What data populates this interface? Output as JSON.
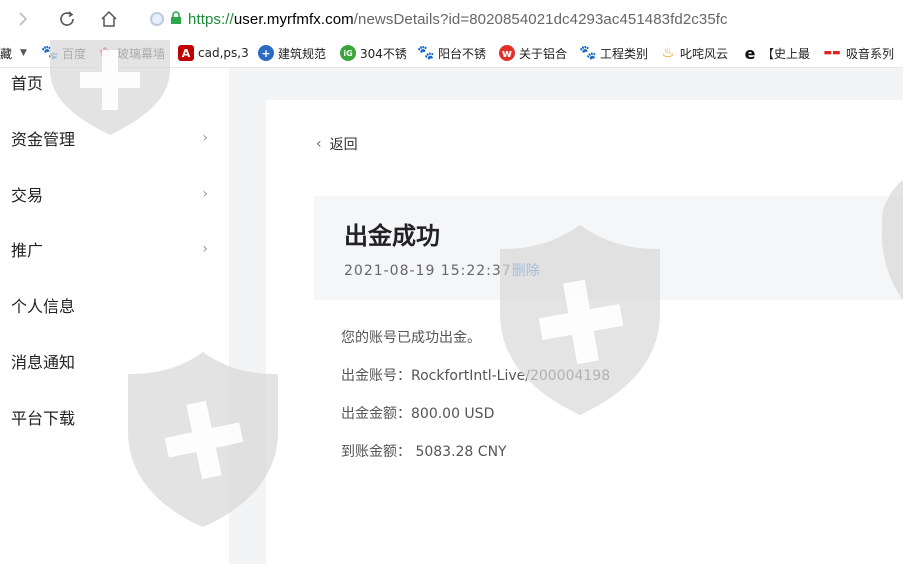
{
  "browser": {
    "url_scheme": "https://",
    "url_host": "user.myrfmfx.com",
    "url_path": "/newsDetails?id=8020854021dc4293ac451483fd2c35fc"
  },
  "bookmarks": [
    {
      "label": "收藏",
      "icon": "bookmark-icon",
      "color": "#888888"
    },
    {
      "label": "百度",
      "icon": "baidu-paw-icon",
      "color": "#3b5fe0"
    },
    {
      "label": "玻璃幕墙",
      "icon": "flower-icon",
      "color": "#e03030"
    },
    {
      "label": "cad,ps,3",
      "icon": "letter-a-icon",
      "color": "#c00000"
    },
    {
      "label": "建筑规范",
      "icon": "cross-circle-icon",
      "color": "#2b6cc4"
    },
    {
      "label": "304不锈",
      "icon": "green-circle-icon",
      "color": "#3aa53a"
    },
    {
      "label": "阳台不锈",
      "icon": "baidu-paw-icon",
      "color": "#3b5fe0"
    },
    {
      "label": "关于铝合",
      "icon": "weibo-icon",
      "color": "#e0302a"
    },
    {
      "label": "工程类别",
      "icon": "baidu-paw-icon",
      "color": "#3b5fe0"
    },
    {
      "label": "叱咤风云",
      "icon": "flame-icon",
      "color": "#f08a00"
    },
    {
      "label": "",
      "icon": "ie-icon",
      "color": "#111111"
    },
    {
      "label": "【史上最",
      "icon": "",
      "color": ""
    },
    {
      "label": "吸音系列",
      "icon": "logo-red-icon",
      "color": "#d22"
    }
  ],
  "sidebar": {
    "items": [
      {
        "label": "首页",
        "has_chevron": false
      },
      {
        "label": "资金管理",
        "has_chevron": true
      },
      {
        "label": "交易",
        "has_chevron": true
      },
      {
        "label": "推广",
        "has_chevron": true
      },
      {
        "label": "个人信息",
        "has_chevron": false
      },
      {
        "label": "消息通知",
        "has_chevron": false
      },
      {
        "label": "平台下载",
        "has_chevron": false
      }
    ]
  },
  "detail": {
    "back_label": "返回",
    "title": "出金成功",
    "timestamp": "2021-08-19 15:22:37",
    "delete_label": "删除",
    "lines": [
      "您的账号已成功出金。",
      "出金账号：RockfortIntl-Live/200004198",
      "出金金额：800.00 USD",
      "到账金额： 5083.28 CNY"
    ]
  },
  "colors": {
    "link_blue": "#2f7ae5",
    "url_green": "#1a8c3a",
    "watermark_gray": "#d9d9d9"
  }
}
